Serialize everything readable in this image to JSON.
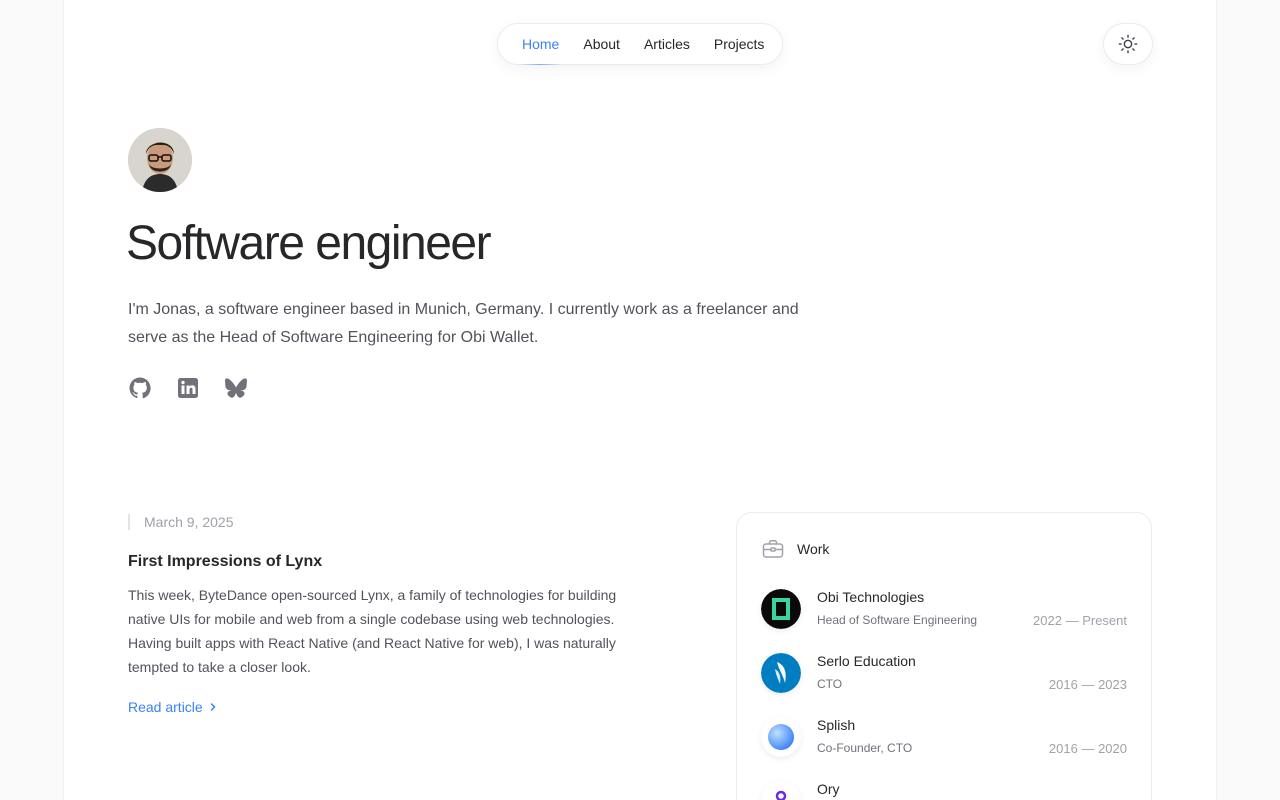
{
  "nav": {
    "items": [
      {
        "label": "Home",
        "active": true
      },
      {
        "label": "About",
        "active": false
      },
      {
        "label": "Articles",
        "active": false
      },
      {
        "label": "Projects",
        "active": false
      }
    ],
    "theme_toggle_icon": "sun-icon"
  },
  "hero": {
    "avatar_icon": "avatar-photo",
    "title": "Software engineer",
    "intro": "I'm Jonas, a software engineer based in Munich, Germany. I currently work as a freelancer and serve as the Head of Software Engineering for Obi Wallet.",
    "socials": [
      "github-icon",
      "linkedin-icon",
      "bluesky-icon"
    ]
  },
  "article": {
    "date": "March 9, 2025",
    "title": "First Impressions of Lynx",
    "description": "This week, ByteDance open-sourced Lynx, a family of technologies for building native UIs for mobile and web from a single codebase using web technologies. Having built apps with React Native (and React Native for web), I was naturally tempted to take a closer look.",
    "link_label": "Read article"
  },
  "work": {
    "heading": "Work",
    "heading_icon": "briefcase-icon",
    "jobs": [
      {
        "company": "Obi Technologies",
        "role": "Head of Software Engineering",
        "dates": "2022 — Present",
        "logo": "obi-logo"
      },
      {
        "company": "Serlo Education",
        "role": "CTO",
        "dates": "2016 — 2023",
        "logo": "serlo-logo"
      },
      {
        "company": "Splish",
        "role": "Co-Founder, CTO",
        "dates": "2016 — 2020",
        "logo": "splish-logo"
      },
      {
        "company": "Ory",
        "role": "",
        "dates": "",
        "logo": "ory-logo"
      }
    ]
  },
  "colors": {
    "accent": "#3b82f6",
    "text": "#27272a",
    "muted": "#71717a",
    "serlo": "#007ec1",
    "obi_green": "#3ad6a0",
    "ory_purple": "#6d28d9"
  }
}
